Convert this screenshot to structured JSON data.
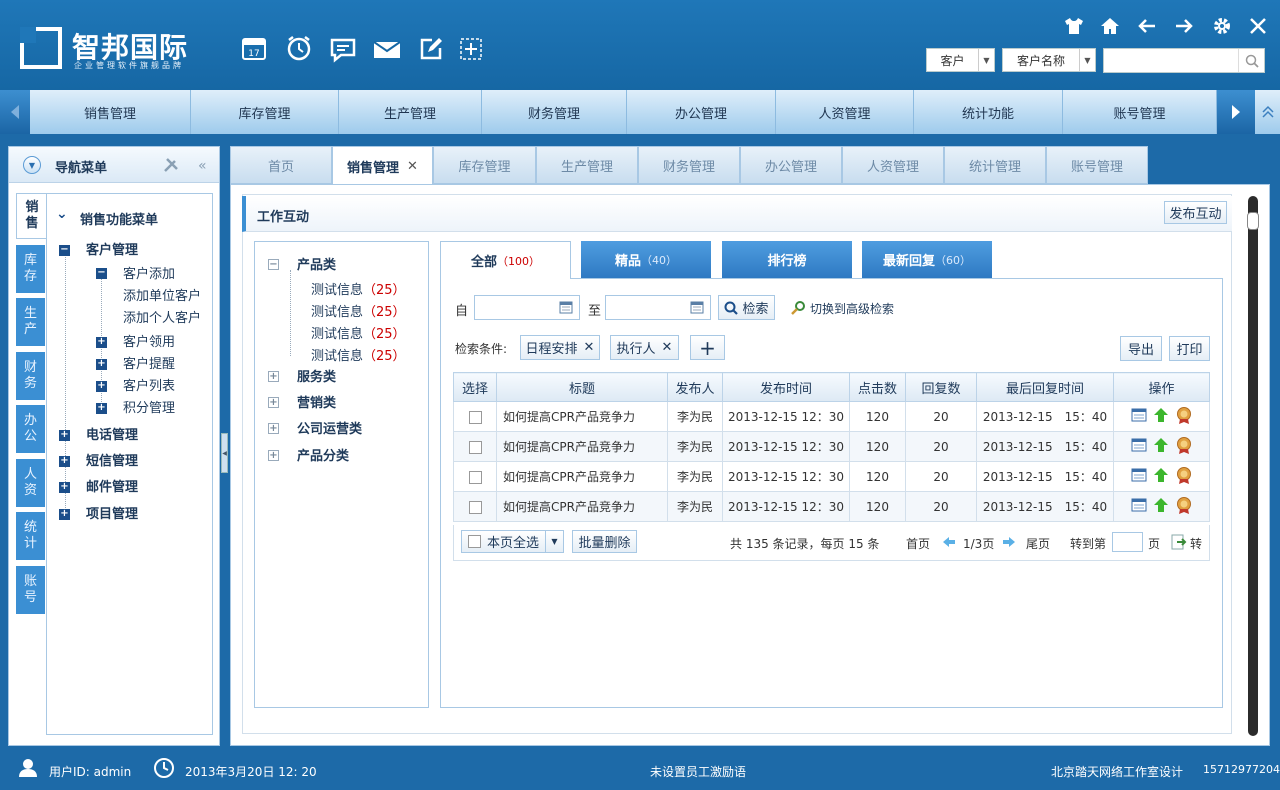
{
  "brand": {
    "title": "智邦国际",
    "subtitle": "企业管理软件旗舰品牌"
  },
  "header": {
    "select1": "客户",
    "select2": "客户名称",
    "search_value": ""
  },
  "mainnav": [
    "销售管理",
    "库存管理",
    "生产管理",
    "财务管理",
    "办公管理",
    "人资管理",
    "统计功能",
    "账号管理"
  ],
  "sidebar": {
    "title": "导航菜单",
    "active_tab": "销售",
    "tabs": [
      "库存",
      "生产",
      "财务",
      "办公",
      "人资",
      "统计",
      "账号"
    ],
    "tree_root": "销售功能菜单",
    "customer_mgmt": "客户管理",
    "customer_add": "客户添加",
    "add_unit": "添加单位客户",
    "add_person": "添加个人客户",
    "customer_get": "客户领用",
    "customer_remind": "客户提醒",
    "customer_list": "客户列表",
    "points_mgmt": "积分管理",
    "phone_mgmt": "电话管理",
    "sms_mgmt": "短信管理",
    "mail_mgmt": "邮件管理",
    "project_mgmt": "项目管理"
  },
  "tabs": [
    "首页",
    "销售管理",
    "库存管理",
    "生产管理",
    "财务管理",
    "办公管理",
    "人资管理",
    "统计管理",
    "账号管理"
  ],
  "panel": {
    "title": "工作互动",
    "publish": "发布互动"
  },
  "categories": {
    "c1": "产品类",
    "items": [
      {
        "label": "测试信息",
        "count": "（25）"
      },
      {
        "label": "测试信息",
        "count": "（25）"
      },
      {
        "label": "测试信息",
        "count": "（25）"
      },
      {
        "label": "测试信息",
        "count": "（25）"
      }
    ],
    "c2": "服务类",
    "c3": "营销类",
    "c4": "公司运营类",
    "c5": "产品分类"
  },
  "itabs": [
    {
      "label": "全部",
      "count": "（100）"
    },
    {
      "label": "精品",
      "count": "（40）"
    },
    {
      "label": "排行榜",
      "count": ""
    },
    {
      "label": "最新回复",
      "count": "（60）"
    }
  ],
  "search": {
    "from": "自",
    "to": "至",
    "btn": "检索",
    "advanced": "切换到高级检索",
    "cond_label": "检索条件:",
    "tag1": "日程安排",
    "tag2": "执行人",
    "export": "导出",
    "print": "打印"
  },
  "table": {
    "headers": [
      "选择",
      "标题",
      "发布人",
      "发布时间",
      "点击数",
      "回复数",
      "最后回复时间",
      "操作"
    ],
    "rows": [
      {
        "title": "如何提高CPR产品竞争力",
        "author": "李为民",
        "time": "2013-12-15 12：30",
        "clicks": "120",
        "replies": "20",
        "last": "2013-12-15　15：40"
      },
      {
        "title": "如何提高CPR产品竞争力",
        "author": "李为民",
        "time": "2013-12-15 12：30",
        "clicks": "120",
        "replies": "20",
        "last": "2013-12-15　15：40"
      },
      {
        "title": "如何提高CPR产品竞争力",
        "author": "李为民",
        "time": "2013-12-15 12：30",
        "clicks": "120",
        "replies": "20",
        "last": "2013-12-15　15：40"
      },
      {
        "title": "如何提高CPR产品竞争力",
        "author": "李为民",
        "time": "2013-12-15 12：30",
        "clicks": "120",
        "replies": "20",
        "last": "2013-12-15　15：40"
      }
    ]
  },
  "pager": {
    "select_all": "本页全选",
    "batch_delete": "批量删除",
    "summary": "共 135 条记录，每页 15 条",
    "first": "首页",
    "page": "1/3页",
    "last": "尾页",
    "goto": "转到第",
    "page_unit": "页",
    "go": "转"
  },
  "footer": {
    "user": "用户ID: admin",
    "datetime": "2013年3月20日 12: 20",
    "notice": "未设置员工激励语",
    "credit": "北京踏天网络工作室设计",
    "phone": "15712977204"
  }
}
